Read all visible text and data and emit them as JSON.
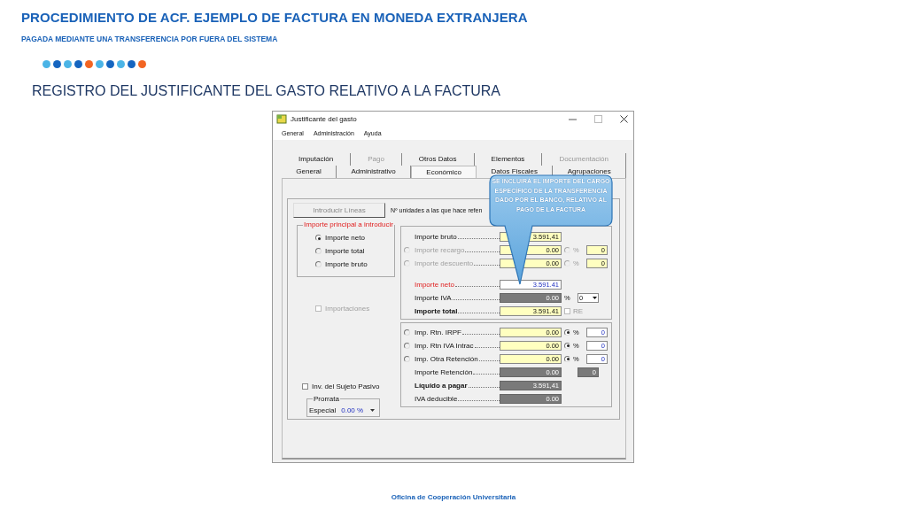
{
  "slide": {
    "title": "PROCEDIMIENTO DE ACF. EJEMPLO DE FACTURA EN MONEDA EXTRANJERA",
    "subtitle": "PAGADA MEDIANTE UNA TRANSFERENCIA POR FUERA DEL SISTEMA",
    "dots": [
      {
        "color": "#4bb4e6"
      },
      {
        "color": "#1565c0"
      },
      {
        "color": "#4bb4e6"
      },
      {
        "color": "#1565c0"
      },
      {
        "color": "#f26522"
      },
      {
        "color": "#4bb4e6"
      },
      {
        "color": "#1565c0"
      },
      {
        "color": "#4bb4e6"
      },
      {
        "color": "#1565c0"
      },
      {
        "color": "#f26522"
      }
    ],
    "heading": "REGISTRO DEL JUSTIFICANTE DEL GASTO RELATIVO A LA FACTURA",
    "footer": "Oficina de Cooperación Universitaria"
  },
  "window": {
    "title": "Justificante del gasto",
    "menu": [
      "General",
      "Administración",
      "Ayuda"
    ],
    "tab_rows": [
      [
        {
          "label": "Imputación",
          "selected": false,
          "disabled": false
        },
        {
          "label": "Pago",
          "selected": false,
          "disabled": true
        },
        {
          "label": "Otros Datos",
          "selected": false,
          "disabled": false
        },
        {
          "label": "Elementos",
          "selected": false,
          "disabled": false
        },
        {
          "label": "Documentación",
          "selected": false,
          "disabled": true
        }
      ],
      [
        {
          "label": "General",
          "selected": false,
          "disabled": false
        },
        {
          "label": "Administrativo",
          "selected": false,
          "disabled": false
        },
        {
          "label": "Económico",
          "selected": true,
          "disabled": false
        },
        {
          "label": "Datos Fiscales",
          "selected": false,
          "disabled": false
        },
        {
          "label": "Agrupaciones",
          "selected": false,
          "disabled": false
        }
      ]
    ],
    "panel": {
      "button": "Introducir Líneas",
      "units_label": "Nº unidades a las que hace refen",
      "principal": {
        "legend": "Importe principal a introducir",
        "options": [
          {
            "label": "Importe neto",
            "selected": true
          },
          {
            "label": "Importe total",
            "selected": false
          },
          {
            "label": "Importe bruto",
            "selected": false
          }
        ]
      },
      "importaciones": {
        "label": "Importaciones",
        "checked": false,
        "disabled": true
      },
      "sujeto_pasivo": {
        "label": "Inv. del Sujeto Pasivo",
        "checked": false,
        "disabled": false
      },
      "prorrata": {
        "legend": "Prorrata",
        "label": "Especial",
        "value": "0.00 %"
      },
      "amounts": [
        {
          "label": "Importe bruto",
          "bold": false,
          "red": false,
          "disabled": false,
          "value": "3.591,41",
          "editable": true,
          "readonly": false
        },
        {
          "label": "Importe recargo",
          "bold": false,
          "red": false,
          "disabled": true,
          "radio": {
            "selected": false
          },
          "value": "0.00",
          "editable": true,
          "readonly": false,
          "extra": {
            "kind": "percent",
            "selected": false,
            "unit": "%",
            "value": "0",
            "editable": true,
            "disabled": true
          }
        },
        {
          "label": "Importe descuento",
          "bold": false,
          "red": false,
          "disabled": true,
          "radio": {
            "selected": false
          },
          "value": "0.00",
          "editable": true,
          "readonly": false,
          "extra": {
            "kind": "percent",
            "selected": false,
            "unit": "%",
            "value": "0",
            "editable": true,
            "disabled": true
          }
        },
        {
          "label": "Importe neto",
          "bold": false,
          "red": true,
          "disabled": false,
          "value": "3.591.41",
          "editable": false,
          "readonly": false
        },
        {
          "label": "Importe IVA",
          "bold": false,
          "red": false,
          "disabled": false,
          "value": "0.00",
          "readonly": true,
          "extra": {
            "kind": "select",
            "unit": "%",
            "value": "0"
          }
        },
        {
          "label": "Importe total",
          "bold": true,
          "red": false,
          "disabled": false,
          "value": "3.591.41",
          "editable": true,
          "readonly": false,
          "extra": {
            "kind": "checkbox",
            "label": "RE",
            "checked": false,
            "disabled": true
          }
        }
      ],
      "retentions": [
        {
          "label": "Imp. Rtn. IRPF",
          "bold": false,
          "red": false,
          "disabled": false,
          "radio": {
            "selected": false
          },
          "value": "0.00",
          "editable": true,
          "readonly": false,
          "extra": {
            "kind": "percent",
            "selected": true,
            "unit": "%",
            "value": "0",
            "editable": false,
            "disabled": false
          }
        },
        {
          "label": "Imp. Rtn IVA Intrac",
          "bold": false,
          "red": false,
          "disabled": false,
          "radio": {
            "selected": false
          },
          "value": "0.00",
          "editable": true,
          "readonly": false,
          "extra": {
            "kind": "percent",
            "selected": true,
            "unit": "%",
            "value": "0",
            "editable": false,
            "disabled": false
          }
        },
        {
          "label": "Imp. Otra Retención",
          "bold": false,
          "red": false,
          "disabled": false,
          "radio": {
            "selected": false
          },
          "value": "0.00",
          "editable": true,
          "readonly": false,
          "extra": {
            "kind": "percent",
            "selected": true,
            "unit": "%",
            "value": "0",
            "editable": false,
            "disabled": false
          }
        },
        {
          "label": "Importe Retención",
          "bold": false,
          "red": false,
          "disabled": false,
          "value": "0.00",
          "readonly": true,
          "extra": {
            "kind": "value",
            "value": "0",
            "readonly": true
          }
        },
        {
          "label": "Líquido a pagar",
          "bold": true,
          "red": false,
          "disabled": false,
          "value": "3.591,41",
          "readonly": true
        },
        {
          "label": "IVA deducible",
          "bold": false,
          "red": false,
          "disabled": false,
          "value": "0.00",
          "readonly": true
        }
      ]
    },
    "callout": {
      "text": "SE INCLUIRÁ EL IMPORTE DEL CARGO ESPECÍFICO DE LA TRANSFERENCIA DADO POR EL BANCO, RELATIVO AL PAGO DE LA FACTURA"
    }
  }
}
